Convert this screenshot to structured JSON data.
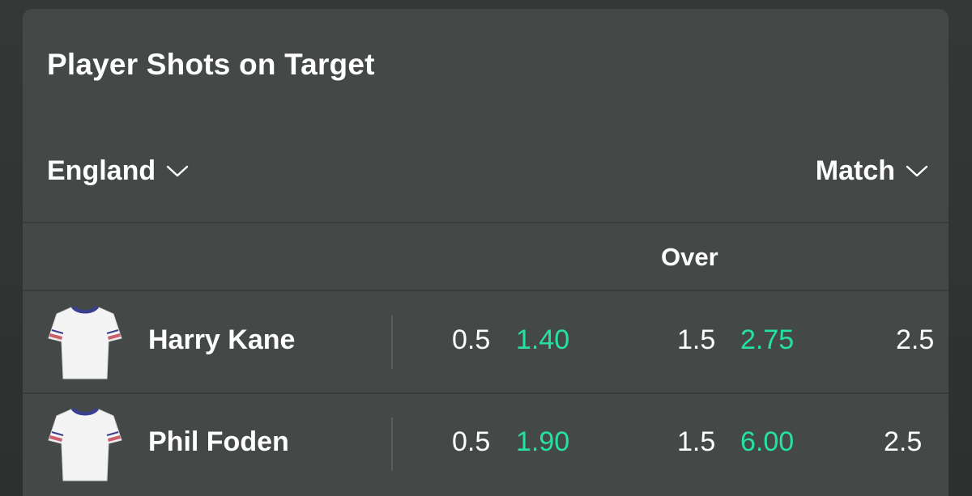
{
  "market": {
    "title": "Player Shots on Target"
  },
  "filters": {
    "team": "England",
    "period": "Match"
  },
  "columns": {
    "over_header": "Over"
  },
  "players": [
    {
      "name": "Harry Kane",
      "lines": [
        {
          "line": "0.5",
          "odds": "1.40"
        },
        {
          "line": "1.5",
          "odds": "2.75"
        },
        {
          "line": "2.5",
          "odds": ""
        }
      ]
    },
    {
      "name": "Phil Foden",
      "lines": [
        {
          "line": "0.5",
          "odds": "1.90"
        },
        {
          "line": "1.5",
          "odds": "6.00"
        },
        {
          "line": "2.5",
          "odds": ""
        }
      ]
    }
  ],
  "colors": {
    "odds": "#25e2a0",
    "card_bg": "#444947",
    "page_bg": "#2f3130"
  },
  "icons": {
    "shirt": "white-kit-shirt-icon",
    "dropdown": "chevron-down-icon"
  }
}
